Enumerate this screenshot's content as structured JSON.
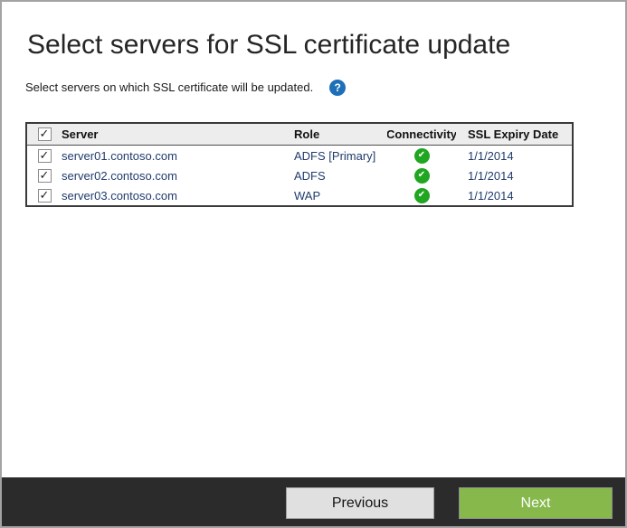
{
  "header": {
    "title": "Select servers for SSL certificate update",
    "subtitle": "Select servers on which SSL certificate will be updated."
  },
  "icons": {
    "help": "?",
    "checkbox_check": "✓",
    "connectivity_ok": "✔"
  },
  "table": {
    "select_all_checked": true,
    "columns": [
      "Server",
      "Role",
      "Connectivity",
      "SSL Expiry Date"
    ],
    "rows": [
      {
        "checked": true,
        "server": "server01.contoso.com",
        "role": "ADFS [Primary]",
        "connectivity": "ok",
        "ssl_expiry_date": "1/1/2014"
      },
      {
        "checked": true,
        "server": "server02.contoso.com",
        "role": "ADFS",
        "connectivity": "ok",
        "ssl_expiry_date": "1/1/2014"
      },
      {
        "checked": true,
        "server": "server03.contoso.com",
        "role": "WAP",
        "connectivity": "ok",
        "ssl_expiry_date": "1/1/2014"
      }
    ]
  },
  "footer": {
    "previous_label": "Previous",
    "next_label": "Next"
  },
  "colors": {
    "link_navy": "#1F3B6D",
    "help_blue": "#1D70B8",
    "status_green": "#21A621",
    "next_green": "#86B84C",
    "footer_dark": "#2B2B2B",
    "table_border": "#3A3A3A"
  }
}
